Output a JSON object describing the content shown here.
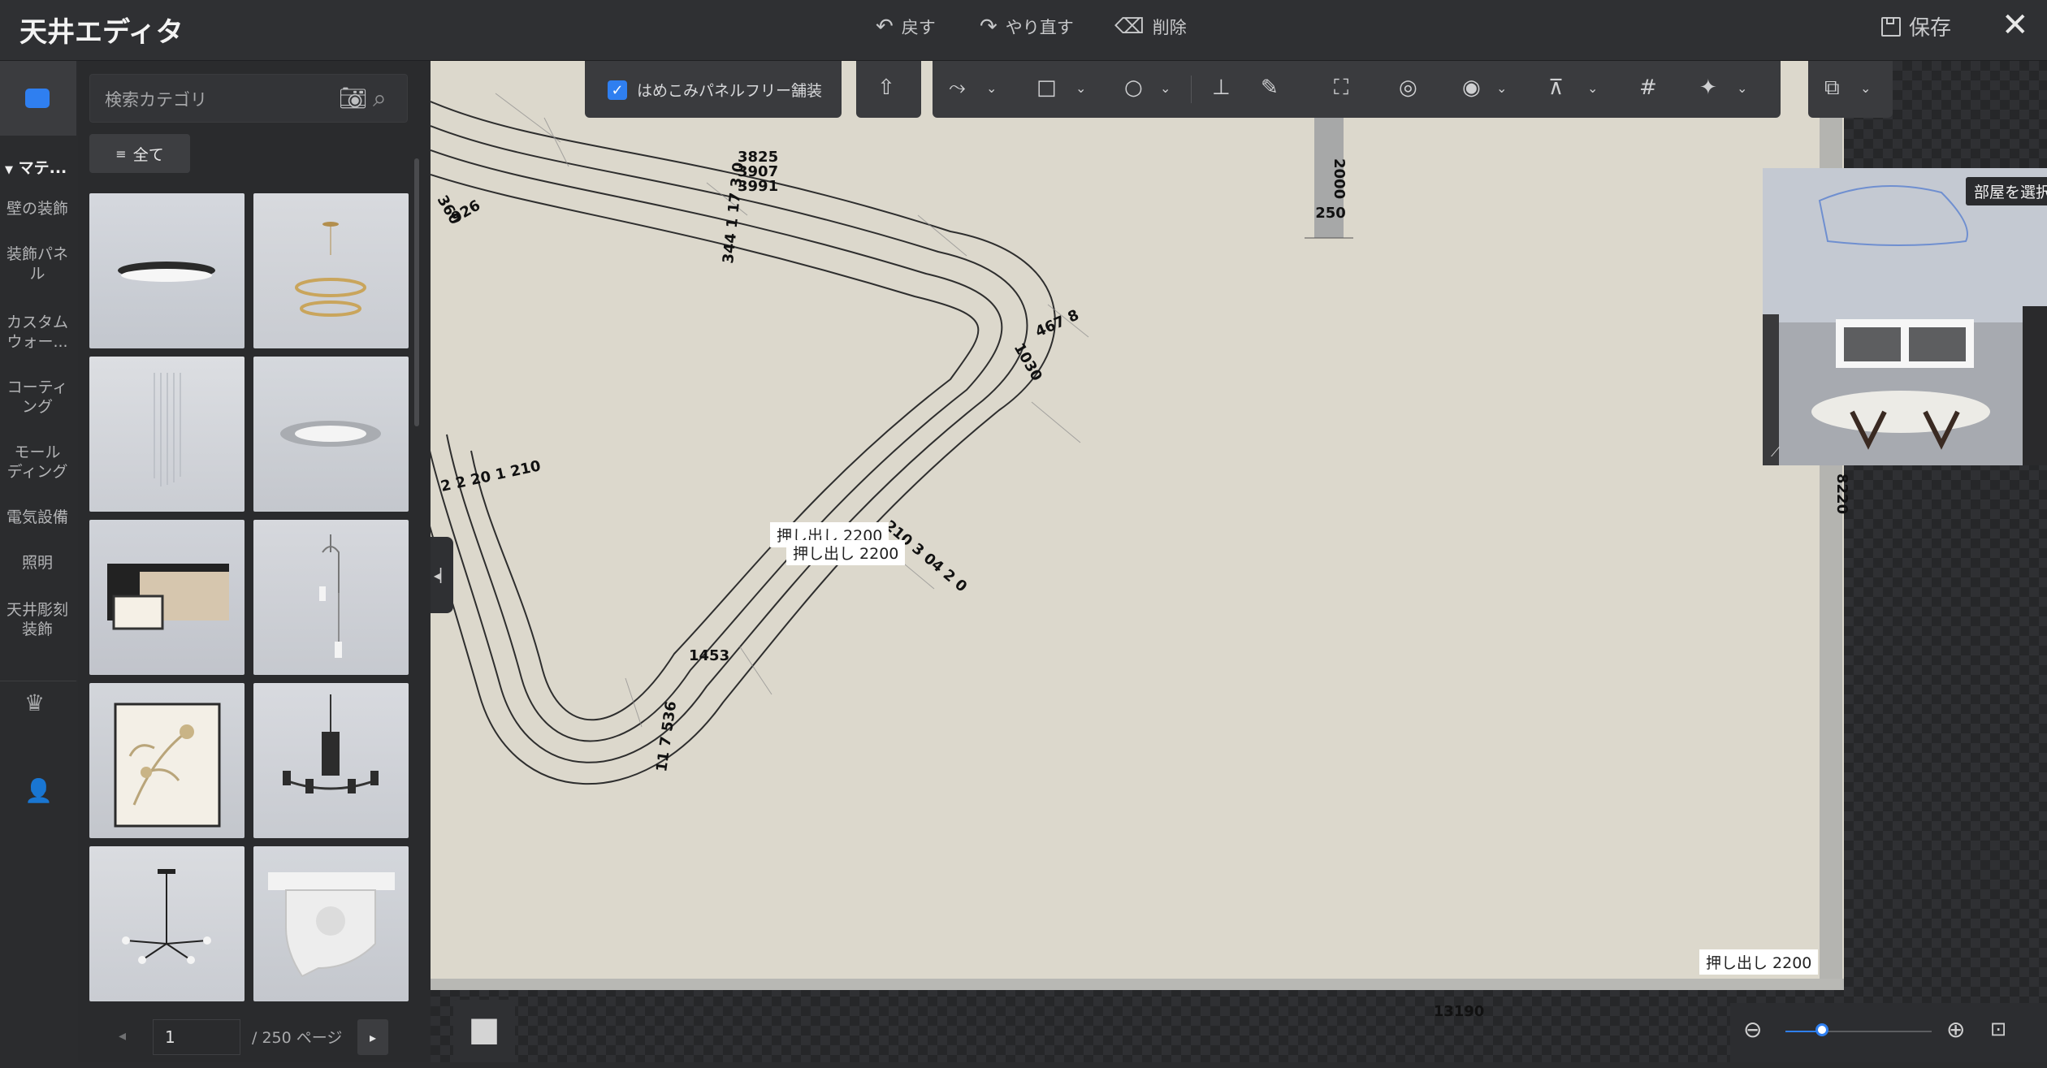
{
  "header": {
    "title": "天井エディタ",
    "undo_label": "戻す",
    "redo_label": "やり直す",
    "delete_label": "削除",
    "save_label": "保存"
  },
  "rail": {
    "section_label": "マテ...",
    "items": [
      {
        "label": "壁の装飾"
      },
      {
        "label": "装飾パネル"
      },
      {
        "label": "カスタムウォー..."
      },
      {
        "label": "コーティング"
      },
      {
        "label": "モールディング"
      },
      {
        "label": "電気設備"
      },
      {
        "label": "照明"
      },
      {
        "label": "天井彫刻装飾"
      }
    ]
  },
  "catalog": {
    "search_placeholder": "検索カテゴリ",
    "filter_all_label": "全て",
    "page_current": "1",
    "page_total": "/ 250 ページ",
    "items": [
      {
        "icon": "round-flush-light"
      },
      {
        "icon": "ring-chandelier"
      },
      {
        "icon": "crystal-chandelier"
      },
      {
        "icon": "recessed-ring-light"
      },
      {
        "icon": "square-panel-light"
      },
      {
        "icon": "pendant-light"
      },
      {
        "icon": "floral-drum-light"
      },
      {
        "icon": "lantern-chandelier"
      },
      {
        "icon": "spider-chandelier"
      },
      {
        "icon": "ornate-corbel"
      }
    ]
  },
  "canvas": {
    "checkbox_label": "はめこみパネルフリー舗装",
    "checkbox_checked": true,
    "preview_tooltip": "部屋を選択",
    "extrusion_labels": [
      "押し出し 2200",
      "押し出し 2200",
      "押し出し 2200"
    ],
    "dimension_labels": {
      "bottom_width": "13190",
      "right_height": "8220",
      "column_width": "250",
      "column_height": "2000",
      "top_a": "3825",
      "top_b": "3907",
      "top_c": "3991",
      "left_a": "360",
      "left_b": "926",
      "seg_1": "344 1 17 3 0",
      "seg_2": "467 8",
      "seg_3": "1030",
      "seg_4": "2 2 20 1 210",
      "seg_5": "210 3 04 2 0",
      "seg_6": "1453",
      "seg_7": "11 7 536"
    },
    "zoom_level": 0.25
  }
}
